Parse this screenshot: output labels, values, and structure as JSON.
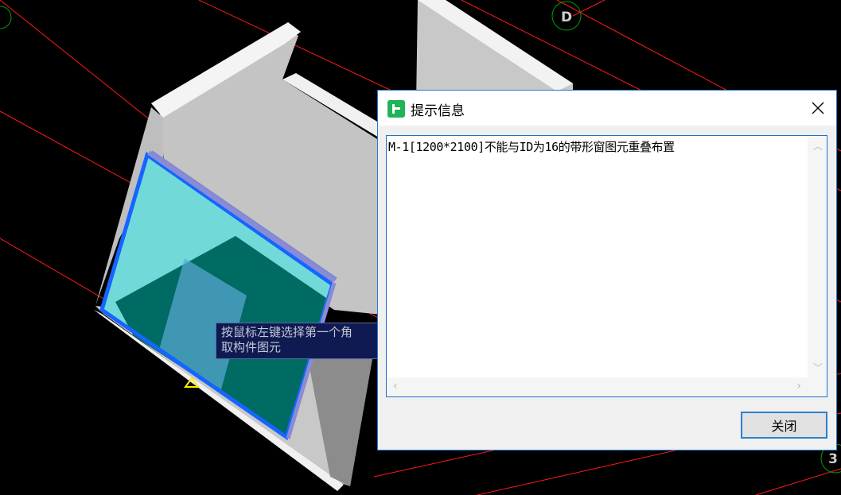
{
  "canvas": {
    "axis_labels": [
      "D",
      "3"
    ],
    "tooltip": {
      "line1": "按鼠标左键选择第一个角",
      "line2": "取构件图元"
    },
    "colors": {
      "grid_line": "#ff0000",
      "axis_circle": "#00a000",
      "wall": "#c8c8c8",
      "wall_top": "#f4f4f4",
      "window_glass": "#74dcdc",
      "window_frame": "#1565ff",
      "marker": "#ffee00"
    }
  },
  "dialog": {
    "title": "提示信息",
    "icon": "app-logo-icon",
    "message": "M-1[1200*2100]不能与ID为16的带形窗图元重叠布置",
    "close_label": "关闭",
    "accent": "#1f7bd6"
  }
}
